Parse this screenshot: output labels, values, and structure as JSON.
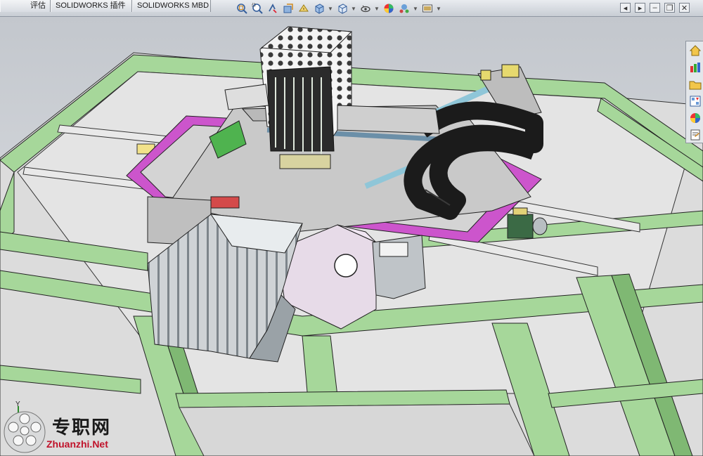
{
  "tabs": [
    {
      "label": "评估"
    },
    {
      "label": "SOLIDWORKS 插件"
    },
    {
      "label": "SOLIDWORKS MBD"
    }
  ],
  "heads_up_toolbar": {
    "icons": [
      "zoom-to-fit-icon",
      "zoom-to-area-icon",
      "previous-view-icon",
      "section-view-icon",
      "dynamic-annotation-icon",
      "view-orientation-icon",
      "display-style-icon",
      "hide-show-items-icon",
      "edit-appearance-icon",
      "apply-scene-icon",
      "view-settings-icon"
    ]
  },
  "window_controls": [
    "previous-window",
    "next-window",
    "restore",
    "close"
  ],
  "task_pane": {
    "icons": [
      "solidworks-resources-icon",
      "design-library-icon",
      "file-explorer-icon",
      "view-palette-icon",
      "appearances-scenes-icon",
      "custom-properties-icon"
    ]
  },
  "triad": {
    "axis_label": "Y"
  },
  "watermark": {
    "cn": "专职网",
    "url": "Zhuanzhi.Net"
  },
  "colors": {
    "frame_green": "#a6d79a",
    "panel_gray": "#dcdcdc",
    "magenta_plate": "#cc55cc",
    "background_top": "#c6cad0",
    "cable_chain": "#1b1b1b"
  }
}
